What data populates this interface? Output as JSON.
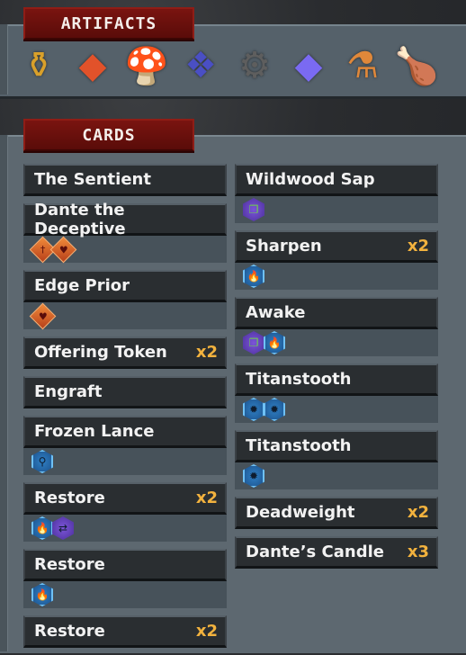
{
  "artifacts": {
    "title": "ARTIFACTS",
    "items": [
      {
        "name": "golden-coffin-artifact",
        "glyph": "⚱",
        "color": "#d9a02a"
      },
      {
        "name": "red-crystal-artifact",
        "glyph": "◆",
        "color": "#e2522a"
      },
      {
        "name": "red-mushroom-artifact",
        "glyph": "🍄",
        "color": "#c43a3a"
      },
      {
        "name": "blue-cloak-artifact",
        "glyph": "❖",
        "color": "#4a4fc4"
      },
      {
        "name": "vine-pipe-artifact",
        "glyph": "⚙",
        "color": "#5e5e5e"
      },
      {
        "name": "purple-crystal-artifact",
        "glyph": "◆",
        "color": "#7a6af2"
      },
      {
        "name": "lantern-flask-artifact",
        "glyph": "⚗",
        "color": "#e0883a"
      },
      {
        "name": "drumstick-artifact",
        "glyph": "🍗",
        "color": "#b56a2a"
      }
    ]
  },
  "cards": {
    "title": "CARDS",
    "left": [
      {
        "name": "The Sentient",
        "count": "",
        "tags": []
      },
      {
        "name": "Dante the Deceptive",
        "count": "",
        "tags": [
          {
            "type": "diamond",
            "icon": "sword-icon",
            "glyph": "†"
          },
          {
            "type": "diamond",
            "icon": "heart-icon",
            "glyph": "♥"
          }
        ]
      },
      {
        "name": "Edge Prior",
        "count": "",
        "tags": [
          {
            "type": "diamond",
            "icon": "heart-icon",
            "glyph": "♥"
          }
        ]
      },
      {
        "name": "Offering Token",
        "count": "x2",
        "tags": []
      },
      {
        "name": "Engraft",
        "count": "",
        "tags": []
      },
      {
        "name": "Frozen Lance",
        "count": "",
        "tags": [
          {
            "type": "hex-blue",
            "icon": "lance-icon",
            "glyph": "⚲"
          }
        ]
      },
      {
        "name": "Restore",
        "count": "x2",
        "tags": [
          {
            "type": "hex-blue",
            "icon": "flame-icon",
            "glyph": "🔥"
          },
          {
            "type": "hex-purple",
            "icon": "transfer-icon",
            "glyph": "⇄"
          }
        ]
      },
      {
        "name": "Restore",
        "count": "",
        "tags": [
          {
            "type": "hex-blue",
            "icon": "flame-icon",
            "glyph": "🔥"
          }
        ]
      },
      {
        "name": "Restore",
        "count": "x2",
        "tags": []
      }
    ],
    "right": [
      {
        "name": "Wildwood Sap",
        "count": "",
        "tags": [
          {
            "type": "hex-purple",
            "icon": "duplicate-icon",
            "glyph": "❐"
          }
        ]
      },
      {
        "name": "Sharpen",
        "count": "x2",
        "tags": [
          {
            "type": "hex-blue",
            "icon": "flame-icon",
            "glyph": "🔥"
          }
        ]
      },
      {
        "name": "Awake",
        "count": "",
        "tags": [
          {
            "type": "hex-purple",
            "icon": "duplicate-icon",
            "glyph": "❐"
          },
          {
            "type": "hex-blue",
            "icon": "flame-icon",
            "glyph": "🔥"
          }
        ]
      },
      {
        "name": "Titanstooth",
        "count": "",
        "tags": [
          {
            "type": "hex-blue",
            "icon": "spike-burst-icon",
            "glyph": "✹"
          },
          {
            "type": "hex-blue",
            "icon": "spike-burst-icon",
            "glyph": "✹"
          }
        ]
      },
      {
        "name": "Titanstooth",
        "count": "",
        "tags": [
          {
            "type": "hex-blue",
            "icon": "spike-burst-icon",
            "glyph": "✹"
          }
        ]
      },
      {
        "name": "Deadweight",
        "count": "x2",
        "tags": []
      },
      {
        "name": "Dante’s Candle",
        "count": "x3",
        "tags": []
      }
    ]
  }
}
